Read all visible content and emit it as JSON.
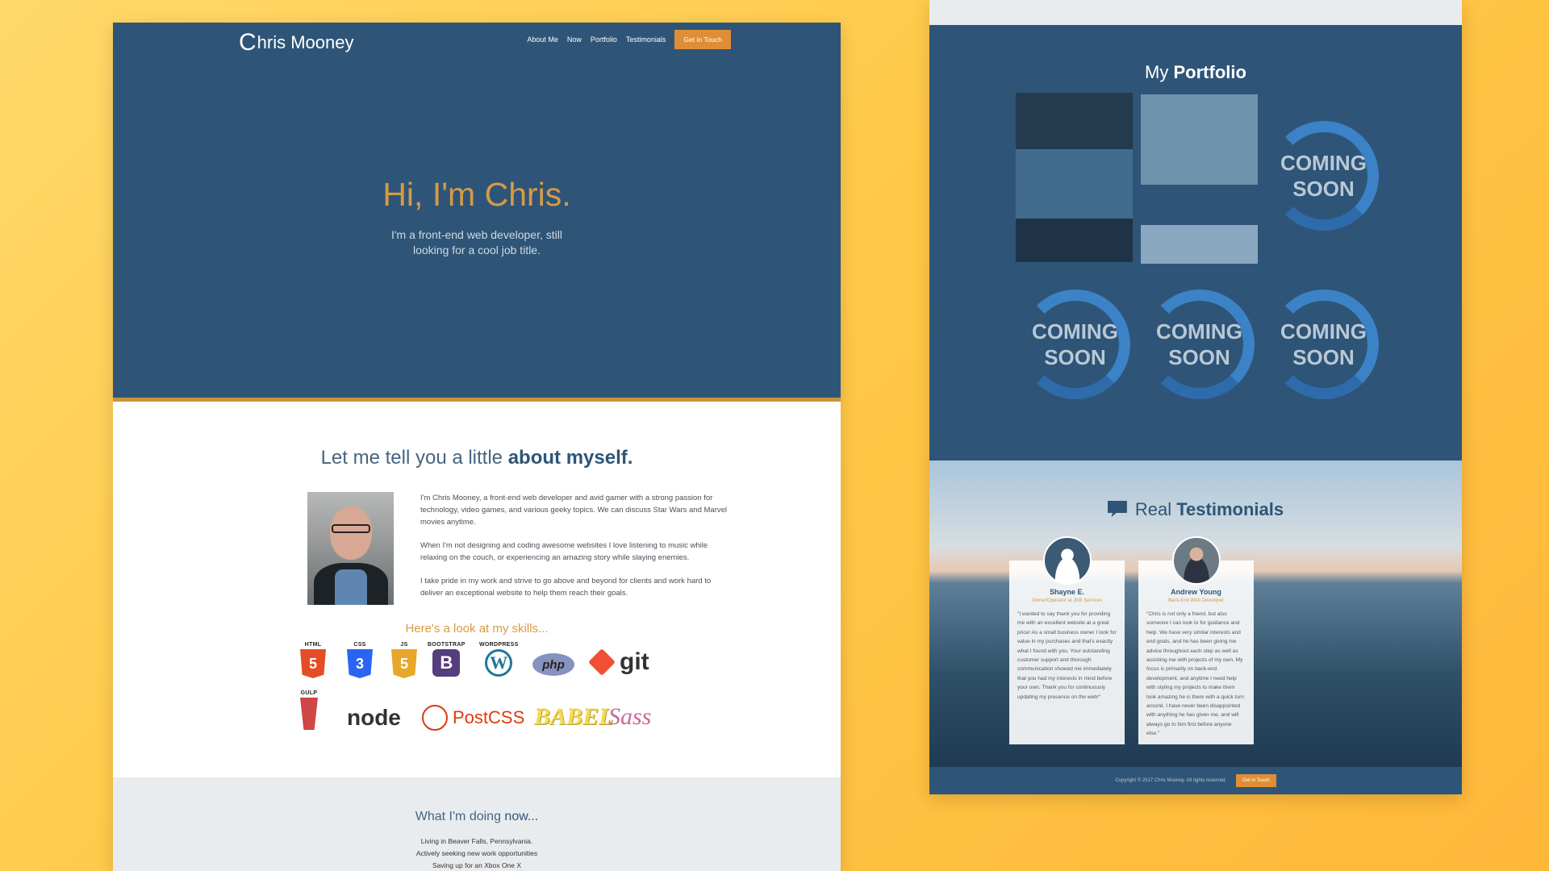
{
  "left": {
    "logo": "hris Mooney",
    "logo_initial": "C",
    "nav": [
      "About Me",
      "Now",
      "Portfolio",
      "Testimonials"
    ],
    "nav_cta": "Get in Touch",
    "hero_title": "Hi, I'm Chris.",
    "hero_subtitle": "I'm a front-end web developer, still looking for a cool job title.",
    "about_heading_light": "Let me tell you a little ",
    "about_heading_bold": "about myself.",
    "bio": [
      "I'm Chris Mooney, a front-end web developer and avid gamer with a strong passion for technology, video games, and various geeky topics. We can discuss Star Wars and Marvel movies anytime.",
      "When I'm not designing and coding awesome websites I love listening to music while relaxing on the couch, or experiencing an amazing story while slaying enemies.",
      "I take pride in my work and strive to go above and beyond for clients and work hard to deliver an exceptional website to help them reach their goals."
    ],
    "skills_title": "Here's a look at my skills...",
    "skills": {
      "html": {
        "label": "HTML",
        "glyph": "5"
      },
      "css": {
        "label": "CSS",
        "glyph": "3"
      },
      "js": {
        "label": "JS",
        "glyph": "5"
      },
      "bootstrap": {
        "label": "BOOTSTRAP",
        "glyph": "B"
      },
      "wordpress": {
        "label": "WORDPRESS",
        "glyph": "W"
      },
      "php": "php",
      "git": "git",
      "gulp": {
        "label": "GULP"
      },
      "node": "node",
      "postcss": "PostCSS",
      "babel": "BABEL",
      "sass": "Sass"
    },
    "now_heading_light": "What I'm doing ",
    "now_heading_bold": "now...",
    "now_items": [
      "Living in Beaver Falls, Pennsylvania.",
      "Actively seeking new work opportunities",
      "Saving up for an Xbox One X"
    ]
  },
  "right": {
    "portfolio_heading_light": "My ",
    "portfolio_heading_bold": "Portfolio",
    "coming_soon": "COMING SOON",
    "testimonials_heading_light": "Real ",
    "testimonials_heading_bold": "Testimonials",
    "testimonials": [
      {
        "name": "Shayne E.",
        "role": "Owner/Operator at JNB Services",
        "quote": "\"I wanted to say thank you for providing me with an excellent website at a great price! As a small business owner I look for value in my purchases and that's exactly what I found with you. Your outstanding customer support and thorough communication showed me immediately that you had my interests in mind before your own. Thank you for continuously updating my presence on the web!\""
      },
      {
        "name": "Andrew Young",
        "role": "Back-End Web Developer",
        "quote": "\"Chris is not only a friend, but also someone I can look to for guidance and help. We have very similar interests and end goals, and he has been giving me advice throughout each step as well as assisting me with projects of my own. My focus is primarily on back-end development, and anytime I need help with styling my projects to make them look amazing he is there with a quick turn around. I have never been disappointed with anything he has given me, and will always go to him first before anyone else.\""
      }
    ],
    "footer_text": "Copyright © 2017 Chris Mooney. All rights reserved.",
    "footer_cta": "Get in Touch"
  },
  "colors": {
    "navy": "#2e5577",
    "gold": "#d79a44",
    "orange": "#df8e35",
    "background": "#ffc947"
  }
}
